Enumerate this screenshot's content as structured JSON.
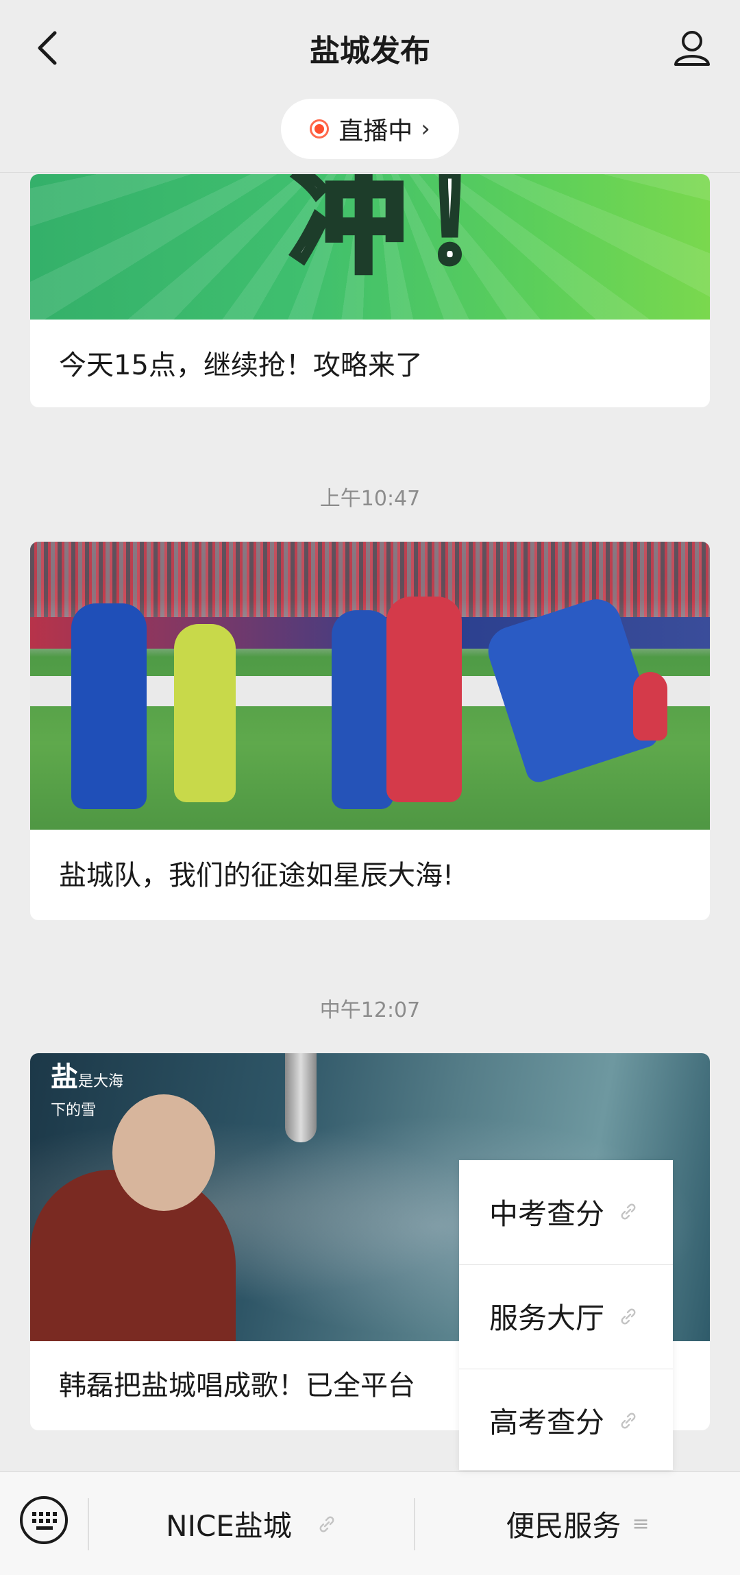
{
  "header": {
    "title": "盐城发布",
    "live_label": "直播中"
  },
  "feed": {
    "items": [
      {
        "caption": "今天15点，继续抢！攻略来了",
        "image_text": "冲！"
      },
      {
        "timestamp": "上午10:47",
        "caption": "盐城队，我们的征途如星辰大海!"
      },
      {
        "timestamp": "中午12:07",
        "caption": "韩磊把盐城唱成歌！已全平台",
        "image_title": "盐",
        "image_subtitle_1": "是大海",
        "image_subtitle_2": "下的雪"
      }
    ]
  },
  "popup_menu": {
    "items": [
      "中考查分",
      "服务大厅",
      "高考查分"
    ]
  },
  "bottom_bar": {
    "menu_1": "NICE盐城",
    "menu_2": "便民服务"
  },
  "colors": {
    "live_dot": "#ff4f2e",
    "background": "#ededed"
  },
  "icons": {
    "back": "chevron-left-icon",
    "profile": "person-icon",
    "keyboard": "keyboard-icon",
    "link": "link-icon",
    "menu": "menu-lines-icon"
  }
}
